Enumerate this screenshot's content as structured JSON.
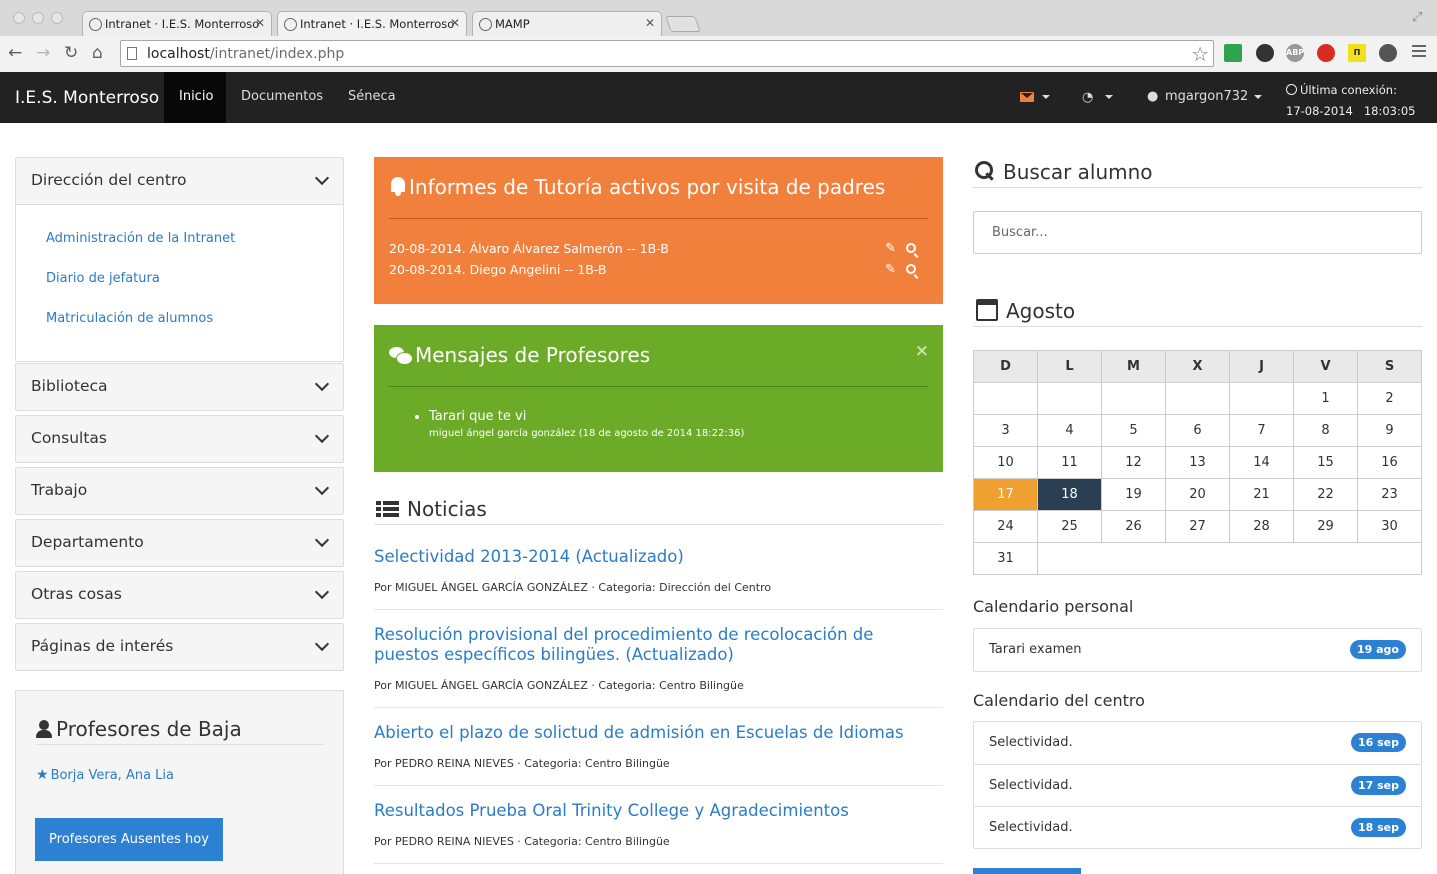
{
  "browser": {
    "tabs": [
      {
        "title": "Intranet · I.E.S. Monterroso",
        "active": false
      },
      {
        "title": "Intranet · I.E.S. Monterroso",
        "active": true
      },
      {
        "title": "MAMP",
        "active": false
      }
    ],
    "url_host": "localhost",
    "url_path": "/intranet/index.php"
  },
  "navbar": {
    "brand": "I.E.S. Monterroso",
    "links": [
      "Inicio",
      "Documentos",
      "Séneca"
    ],
    "user": "mgargon732",
    "last_conn_label": "Última conexión:",
    "last_conn_date": "17-08-2014",
    "last_conn_time": "18:03:05"
  },
  "sidebar": {
    "sections": [
      {
        "label": "Dirección del centro",
        "expanded": true,
        "links": [
          "Administración de la Intranet",
          "Diario de jefatura",
          "Matriculación de alumnos"
        ]
      },
      {
        "label": "Biblioteca"
      },
      {
        "label": "Consultas"
      },
      {
        "label": "Trabajo"
      },
      {
        "label": "Departamento"
      },
      {
        "label": "Otras cosas"
      },
      {
        "label": "Páginas de interés"
      }
    ],
    "baja": {
      "title": "Profesores de Baja",
      "teacher": "Borja Vera, Ana Lia",
      "button": "Profesores Ausentes hoy"
    }
  },
  "tutoria": {
    "title": "Informes de Tutoría activos por visita de padres",
    "items": [
      "20-08-2014. Álvaro Álvarez Salmerón -- 1B-B",
      "20-08-2014. Diego Angelini -- 1B-B"
    ],
    "color": "#f0803c"
  },
  "mensajes": {
    "title": "Mensajes de Profesores",
    "close": "×",
    "message": "Tarari que te vi",
    "meta": "miguel ángel garcía gonzález (18 de agosto de 2014 18:22:36)",
    "color": "#6cab27"
  },
  "noticias": {
    "title": "Noticias",
    "items": [
      {
        "title": "Selectividad 2013-2014 (Actualizado)",
        "meta": "Por MIGUEL ÁNGEL GARCÍA GONZÁLEZ · Categoria: Dirección del Centro"
      },
      {
        "title": "Resolución provisional del procedimiento de recolocación de puestos específicos bilingües. (Actualizado)",
        "meta": "Por MIGUEL ÁNGEL GARCÍA GONZÁLEZ · Categoria: Centro Bilingüe"
      },
      {
        "title": "Abierto el plazo de solictud de admisión en Escuelas de Idiomas",
        "meta": "Por PEDRO REINA NIEVES · Categoria: Centro Bilingüe"
      },
      {
        "title": "Resultados Prueba Oral Trinity College y Agradecimientos",
        "meta": "Por PEDRO REINA NIEVES · Categoria: Centro Bilingüe"
      }
    ]
  },
  "buscar": {
    "title": "Buscar alumno",
    "placeholder": "Buscar..."
  },
  "calendar": {
    "month": "Agosto",
    "days": [
      "D",
      "L",
      "M",
      "X",
      "J",
      "V",
      "S"
    ],
    "weeks": [
      [
        "",
        "",
        "",
        "",
        "",
        "1",
        "2"
      ],
      [
        "3",
        "4",
        "5",
        "6",
        "7",
        "8",
        "9"
      ],
      [
        "10",
        "11",
        "12",
        "13",
        "14",
        "15",
        "16"
      ],
      [
        "17",
        "18",
        "19",
        "20",
        "21",
        "22",
        "23"
      ],
      [
        "24",
        "25",
        "26",
        "27",
        "28",
        "29",
        "30"
      ],
      [
        "31"
      ]
    ],
    "today": "17",
    "selected": "18",
    "today_color": "#f0a030",
    "selected_color": "#2a3e54"
  },
  "personal": {
    "title": "Calendario personal",
    "events": [
      {
        "text": "Tarari examen",
        "badge": "19 ago"
      }
    ]
  },
  "centro": {
    "title": "Calendario del centro",
    "events": [
      {
        "text": "Selectividad.",
        "badge": "16 sep"
      },
      {
        "text": "Selectividad.",
        "badge": "17 sep"
      },
      {
        "text": "Selectividad.",
        "badge": "18 sep"
      }
    ]
  },
  "accent": "#2d81d3"
}
